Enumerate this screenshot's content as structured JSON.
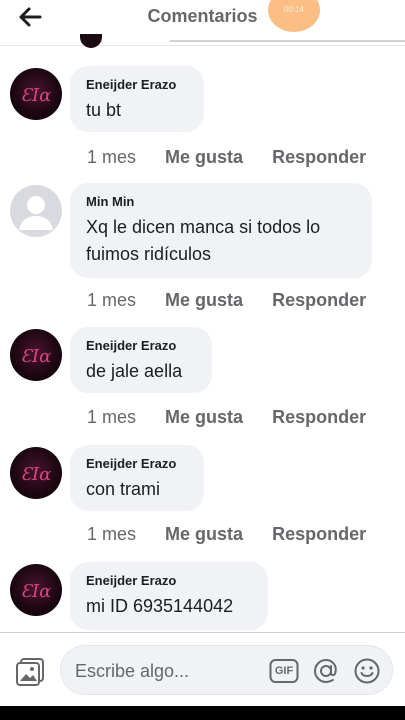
{
  "header": {
    "title": "Comentarios",
    "back_icon": "arrow-left-icon",
    "badge_text": "00:14"
  },
  "comments": [
    {
      "author": "Eneijder Erazo",
      "text": "tu bt",
      "avatar": "dark",
      "time": "1 mes",
      "like": "Me gusta",
      "reply": "Responder"
    },
    {
      "author": "Min Min",
      "text_lines": [
        "Xq le dicen manca si todos lo",
        "fuimos ridículos"
      ],
      "avatar": "default",
      "time": "1 mes",
      "like": "Me gusta",
      "reply": "Responder"
    },
    {
      "author": "Eneijder Erazo",
      "text": "de jale aella",
      "avatar": "dark",
      "time": "1 mes",
      "like": "Me gusta",
      "reply": "Responder"
    },
    {
      "author": "Eneijder Erazo",
      "text": "con trami",
      "avatar": "dark",
      "time": "1 mes",
      "like": "Me gusta",
      "reply": "Responder"
    },
    {
      "author": "Eneijder Erazo",
      "text": "mi ID 6935144042",
      "avatar": "dark"
    }
  ],
  "composer": {
    "placeholder": "Escribe algo...",
    "photo_icon": "photo-icon",
    "gif_label": "GIF",
    "at_icon": "mention-icon",
    "emoji_icon": "emoji-icon"
  },
  "colors": {
    "bubble": "#f0f2f5",
    "meta_text": "#65676b",
    "badge": "#fbb878"
  }
}
